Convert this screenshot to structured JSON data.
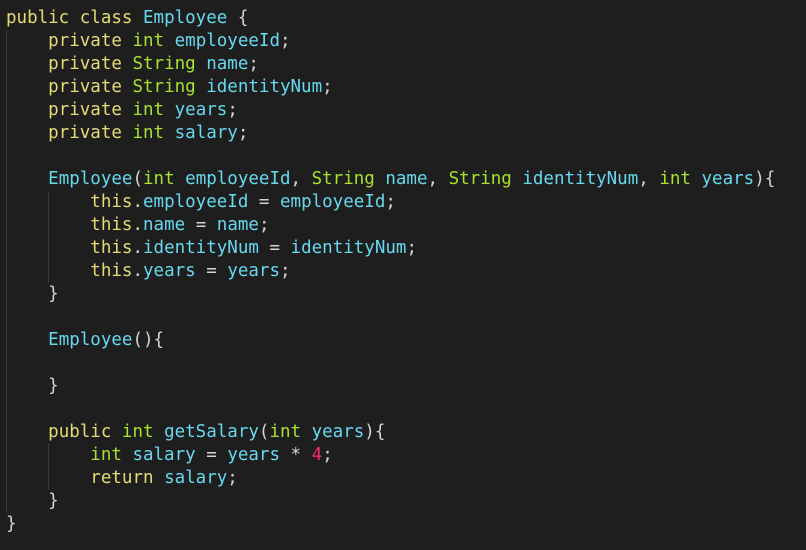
{
  "editor": {
    "lines": [
      [
        {
          "t": "public",
          "c": "kw"
        },
        {
          "t": " ",
          "c": "punc"
        },
        {
          "t": "class",
          "c": "kw"
        },
        {
          "t": " ",
          "c": "punc"
        },
        {
          "t": "Employee",
          "c": "name"
        },
        {
          "t": " {",
          "c": "punc"
        }
      ],
      [
        {
          "t": "    ",
          "c": "punc"
        },
        {
          "t": "private",
          "c": "kw"
        },
        {
          "t": " ",
          "c": "punc"
        },
        {
          "t": "int",
          "c": "type"
        },
        {
          "t": " ",
          "c": "punc"
        },
        {
          "t": "employeeId",
          "c": "id"
        },
        {
          "t": ";",
          "c": "punc"
        }
      ],
      [
        {
          "t": "    ",
          "c": "punc"
        },
        {
          "t": "private",
          "c": "kw"
        },
        {
          "t": " ",
          "c": "punc"
        },
        {
          "t": "String",
          "c": "type"
        },
        {
          "t": " ",
          "c": "punc"
        },
        {
          "t": "name",
          "c": "id"
        },
        {
          "t": ";",
          "c": "punc"
        }
      ],
      [
        {
          "t": "    ",
          "c": "punc"
        },
        {
          "t": "private",
          "c": "kw"
        },
        {
          "t": " ",
          "c": "punc"
        },
        {
          "t": "String",
          "c": "type"
        },
        {
          "t": " ",
          "c": "punc"
        },
        {
          "t": "identityNum",
          "c": "id"
        },
        {
          "t": ";",
          "c": "punc"
        }
      ],
      [
        {
          "t": "    ",
          "c": "punc"
        },
        {
          "t": "private",
          "c": "kw"
        },
        {
          "t": " ",
          "c": "punc"
        },
        {
          "t": "int",
          "c": "type"
        },
        {
          "t": " ",
          "c": "punc"
        },
        {
          "t": "years",
          "c": "id"
        },
        {
          "t": ";",
          "c": "punc"
        }
      ],
      [
        {
          "t": "    ",
          "c": "punc"
        },
        {
          "t": "private",
          "c": "kw"
        },
        {
          "t": " ",
          "c": "punc"
        },
        {
          "t": "int",
          "c": "type"
        },
        {
          "t": " ",
          "c": "punc"
        },
        {
          "t": "salary",
          "c": "id"
        },
        {
          "t": ";",
          "c": "punc"
        }
      ],
      [],
      [
        {
          "t": "    ",
          "c": "punc"
        },
        {
          "t": "Employee",
          "c": "name"
        },
        {
          "t": "(",
          "c": "punc"
        },
        {
          "t": "int",
          "c": "type"
        },
        {
          "t": " ",
          "c": "punc"
        },
        {
          "t": "employeeId",
          "c": "id"
        },
        {
          "t": ", ",
          "c": "punc"
        },
        {
          "t": "String",
          "c": "type"
        },
        {
          "t": " ",
          "c": "punc"
        },
        {
          "t": "name",
          "c": "id"
        },
        {
          "t": ", ",
          "c": "punc"
        },
        {
          "t": "String",
          "c": "type"
        },
        {
          "t": " ",
          "c": "punc"
        },
        {
          "t": "identityNum",
          "c": "id"
        },
        {
          "t": ", ",
          "c": "punc"
        },
        {
          "t": "int",
          "c": "type"
        },
        {
          "t": " ",
          "c": "punc"
        },
        {
          "t": "years",
          "c": "id"
        },
        {
          "t": "){",
          "c": "punc"
        }
      ],
      [
        {
          "t": "        ",
          "c": "punc"
        },
        {
          "t": "this",
          "c": "kw2"
        },
        {
          "t": ".",
          "c": "punc"
        },
        {
          "t": "employeeId",
          "c": "id"
        },
        {
          "t": " ",
          "c": "punc"
        },
        {
          "t": "=",
          "c": "op"
        },
        {
          "t": " ",
          "c": "punc"
        },
        {
          "t": "employeeId",
          "c": "id"
        },
        {
          "t": ";",
          "c": "punc"
        }
      ],
      [
        {
          "t": "        ",
          "c": "punc"
        },
        {
          "t": "this",
          "c": "kw2"
        },
        {
          "t": ".",
          "c": "punc"
        },
        {
          "t": "name",
          "c": "id"
        },
        {
          "t": " ",
          "c": "punc"
        },
        {
          "t": "=",
          "c": "op"
        },
        {
          "t": " ",
          "c": "punc"
        },
        {
          "t": "name",
          "c": "id"
        },
        {
          "t": ";",
          "c": "punc"
        }
      ],
      [
        {
          "t": "        ",
          "c": "punc"
        },
        {
          "t": "this",
          "c": "kw2"
        },
        {
          "t": ".",
          "c": "punc"
        },
        {
          "t": "identityNum",
          "c": "id"
        },
        {
          "t": " ",
          "c": "punc"
        },
        {
          "t": "=",
          "c": "op"
        },
        {
          "t": " ",
          "c": "punc"
        },
        {
          "t": "identityNum",
          "c": "id"
        },
        {
          "t": ";",
          "c": "punc"
        }
      ],
      [
        {
          "t": "        ",
          "c": "punc"
        },
        {
          "t": "this",
          "c": "kw2"
        },
        {
          "t": ".",
          "c": "punc"
        },
        {
          "t": "years",
          "c": "id"
        },
        {
          "t": " ",
          "c": "punc"
        },
        {
          "t": "=",
          "c": "op"
        },
        {
          "t": " ",
          "c": "punc"
        },
        {
          "t": "years",
          "c": "id"
        },
        {
          "t": ";",
          "c": "punc"
        }
      ],
      [
        {
          "t": "    ",
          "c": "punc"
        },
        {
          "t": "}",
          "c": "punc"
        }
      ],
      [],
      [
        {
          "t": "    ",
          "c": "punc"
        },
        {
          "t": "Employee",
          "c": "name"
        },
        {
          "t": "(){",
          "c": "punc"
        }
      ],
      [],
      [
        {
          "t": "    ",
          "c": "punc"
        },
        {
          "t": "}",
          "c": "punc"
        }
      ],
      [],
      [
        {
          "t": "    ",
          "c": "punc"
        },
        {
          "t": "public",
          "c": "kw"
        },
        {
          "t": " ",
          "c": "punc"
        },
        {
          "t": "int",
          "c": "type"
        },
        {
          "t": " ",
          "c": "punc"
        },
        {
          "t": "getSalary",
          "c": "name"
        },
        {
          "t": "(",
          "c": "punc"
        },
        {
          "t": "int",
          "c": "type"
        },
        {
          "t": " ",
          "c": "punc"
        },
        {
          "t": "years",
          "c": "id"
        },
        {
          "t": "){",
          "c": "punc"
        }
      ],
      [
        {
          "t": "        ",
          "c": "punc"
        },
        {
          "t": "int",
          "c": "type"
        },
        {
          "t": " ",
          "c": "punc"
        },
        {
          "t": "salary",
          "c": "id"
        },
        {
          "t": " ",
          "c": "punc"
        },
        {
          "t": "=",
          "c": "op"
        },
        {
          "t": " ",
          "c": "punc"
        },
        {
          "t": "years",
          "c": "id"
        },
        {
          "t": " ",
          "c": "punc"
        },
        {
          "t": "*",
          "c": "op"
        },
        {
          "t": " ",
          "c": "punc"
        },
        {
          "t": "4",
          "c": "num"
        },
        {
          "t": ";",
          "c": "punc"
        }
      ],
      [
        {
          "t": "        ",
          "c": "punc"
        },
        {
          "t": "return",
          "c": "kw"
        },
        {
          "t": " ",
          "c": "punc"
        },
        {
          "t": "salary",
          "c": "id"
        },
        {
          "t": ";",
          "c": "punc"
        }
      ],
      [
        {
          "t": "    ",
          "c": "punc"
        },
        {
          "t": "}",
          "c": "punc"
        }
      ],
      [
        {
          "t": "}",
          "c": "punc"
        }
      ]
    ],
    "colors": {
      "background": "#1e1e1e",
      "keyword": "#e6db74",
      "type": "#a6e22e",
      "identifier": "#66d9ef",
      "number": "#f92672",
      "text": "#d4d4d4"
    }
  }
}
